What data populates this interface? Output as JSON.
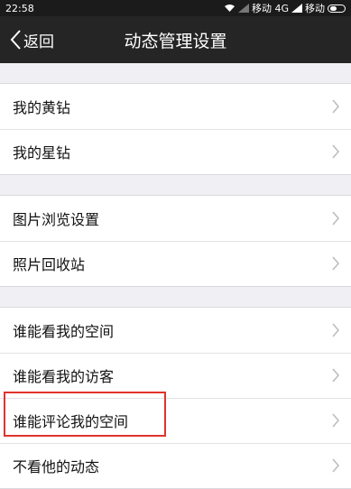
{
  "status_bar": {
    "time": "22:58",
    "carrier1": "移动 4G",
    "carrier2": "移动",
    "icons": [
      "wifi-icon",
      "signal-icon",
      "battery-icon"
    ]
  },
  "nav": {
    "back_label": "返回",
    "title": "动态管理设置"
  },
  "groups": [
    {
      "items": [
        "我的黄钻",
        "我的星钻"
      ]
    },
    {
      "items": [
        "图片浏览设置",
        "照片回收站"
      ]
    },
    {
      "items": [
        "谁能看我的空间",
        "谁能看我的访客",
        "谁能评论我的空间",
        "不看他的动态"
      ]
    }
  ],
  "highlight_color": "#e0332d"
}
